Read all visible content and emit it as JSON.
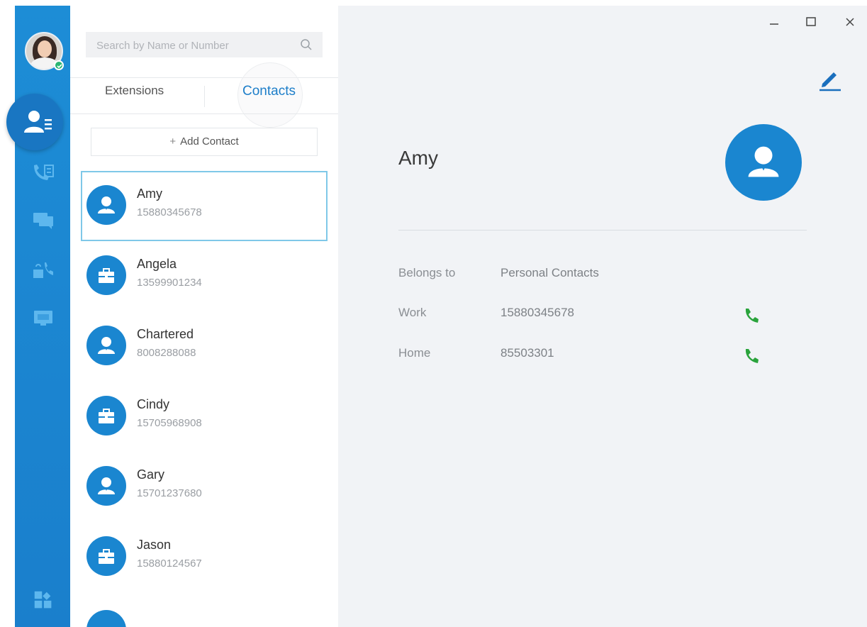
{
  "search": {
    "placeholder": "Search by Name or Number"
  },
  "tabs": {
    "extensions": "Extensions",
    "contacts": "Contacts"
  },
  "add_contact_label": "Add Contact",
  "contacts": [
    {
      "name": "Amy",
      "number": "15880345678",
      "type": "person",
      "selected": true
    },
    {
      "name": "Angela",
      "number": "13599901234",
      "type": "company"
    },
    {
      "name": "Chartered",
      "number": "8008288088",
      "type": "person"
    },
    {
      "name": "Cindy",
      "number": "15705968908",
      "type": "company"
    },
    {
      "name": "Gary",
      "number": "15701237680",
      "type": "person"
    },
    {
      "name": "Jason",
      "number": "15880124567",
      "type": "company"
    }
  ],
  "detail": {
    "name": "Amy",
    "belongs_to_label": "Belongs to",
    "belongs_to_value": "Personal Contacts",
    "phones": [
      {
        "label": "Work",
        "number": "15880345678"
      },
      {
        "label": "Home",
        "number": "85503301"
      }
    ]
  },
  "colors": {
    "accent": "#1a86d0",
    "rail": "#1d8dd6",
    "call": "#2aa33c",
    "detail_bg": "#f1f3f6"
  },
  "icons": {
    "rail": [
      "contacts-icon",
      "call-log-icon",
      "chat-icon",
      "voicemail-icon",
      "conference-icon",
      "apps-icon"
    ]
  }
}
